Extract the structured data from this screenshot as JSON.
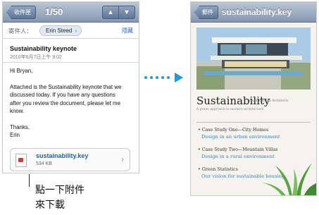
{
  "mail": {
    "nav": {
      "back_label": "收件匣",
      "counter": "1/50",
      "up_arrow": "▲",
      "down_arrow": "▼"
    },
    "from_label": "寄件人：",
    "from_name": "Erin Steed",
    "from_chevron": "›",
    "hide_label": "隱藏",
    "subject": "Sustainability keynote",
    "date": "2010年6月7日上午 9:02",
    "greeting": "Hi Bryan,",
    "body_lines": [
      "Attached is the Sustainability keynote that we",
      "discussed today. If you have any questions",
      "after you review the document, please let me",
      "know."
    ],
    "signoff": [
      "Thanks,",
      "Erin"
    ],
    "attachment": {
      "name": "sustainability.key",
      "size": "534 KB",
      "chevron": "›"
    }
  },
  "callout": {
    "line1": "點一下附件",
    "line2": "來下載"
  },
  "preview": {
    "back_label": "郵件",
    "title": "sustainability.key",
    "doc_title": "Sustainability",
    "doc_subtitle": "Jason Roberts Architects",
    "doc_tagline": "A green approach to modern architecture",
    "sections": [
      {
        "title": "Case Study One—City Homes",
        "desc": "Design in an urban environment"
      },
      {
        "title": "Case Study Two—Mountain Villas",
        "desc": "Design in a rural environment"
      },
      {
        "title": "Green Statistics",
        "desc": "Our vision for sustainable housing"
      }
    ]
  },
  "colors": {
    "accent": "#1f9ad6",
    "link": "#1e5fc2",
    "nav": "#8698b0"
  }
}
